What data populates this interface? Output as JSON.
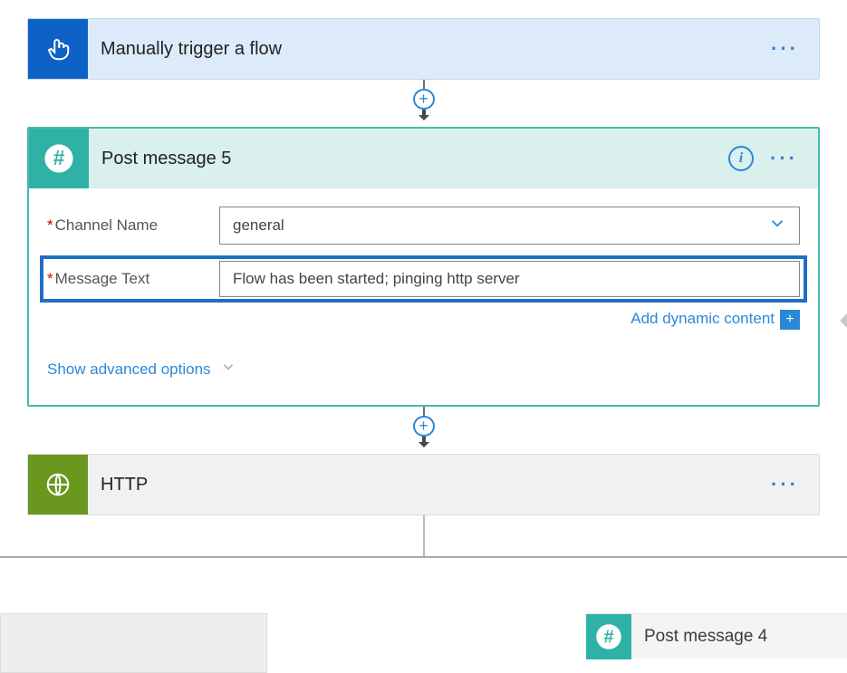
{
  "trigger": {
    "title": "Manually trigger a flow"
  },
  "postMessage": {
    "title": "Post message 5",
    "fields": {
      "channelLabel": "Channel Name",
      "channelValue": "general",
      "messageLabel": "Message Text",
      "messageValue": "Flow has been started; pinging http server"
    },
    "addDynamic": "Add dynamic content",
    "advanced": "Show advanced options"
  },
  "http": {
    "title": "HTTP"
  },
  "branch": {
    "rightTitle": "Post message 4"
  },
  "glyphs": {
    "plus": "+",
    "info": "i",
    "menu": "···"
  }
}
